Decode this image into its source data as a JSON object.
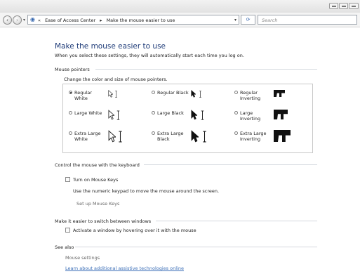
{
  "nav": {
    "crumbs": [
      "«",
      "Ease of Access Center",
      "▸",
      "Make the mouse easier to use"
    ],
    "refresh_glyph": "⟳",
    "search_placeholder": "Search"
  },
  "page": {
    "heading": "Make the mouse easier to use",
    "subtitle": "When you select these settings, they will automatically start each time you log on."
  },
  "pointers": {
    "section": "Mouse pointers",
    "instruction": "Change the color and size of mouse pointers.",
    "options": [
      {
        "label": "Regular\nWhite",
        "selected": true,
        "scheme": "white",
        "size": "regular"
      },
      {
        "label": "Regular Black",
        "selected": false,
        "scheme": "black",
        "size": "regular"
      },
      {
        "label": "Regular\nInverting",
        "selected": false,
        "scheme": "inverting",
        "size": "regular"
      },
      {
        "label": "Large White",
        "selected": false,
        "scheme": "white",
        "size": "large"
      },
      {
        "label": "Large Black",
        "selected": false,
        "scheme": "black",
        "size": "large"
      },
      {
        "label": "Large\nInverting",
        "selected": false,
        "scheme": "inverting",
        "size": "large"
      },
      {
        "label": "Extra Large\nWhite",
        "selected": false,
        "scheme": "white",
        "size": "extra-large"
      },
      {
        "label": "Extra Large\nBlack",
        "selected": false,
        "scheme": "black",
        "size": "extra-large"
      },
      {
        "label": "Extra Large\nInverting",
        "selected": false,
        "scheme": "inverting",
        "size": "extra-large"
      }
    ]
  },
  "keyboard": {
    "section": "Control the mouse with the keyboard",
    "checkbox": "Turn on Mouse Keys",
    "checked": false,
    "description": "Use the numeric keypad to move the mouse around the screen.",
    "link": "Set up Mouse Keys"
  },
  "windows": {
    "section": "Make it easier to switch between windows",
    "checkbox": "Activate a window by hovering over it with the mouse",
    "checked": false
  },
  "see_also": {
    "section": "See also",
    "links": [
      "Mouse settings",
      "Learn about additional assistive technologies online"
    ]
  },
  "colors": {
    "heading": "#1e3b78",
    "link": "#3c6fb8"
  }
}
